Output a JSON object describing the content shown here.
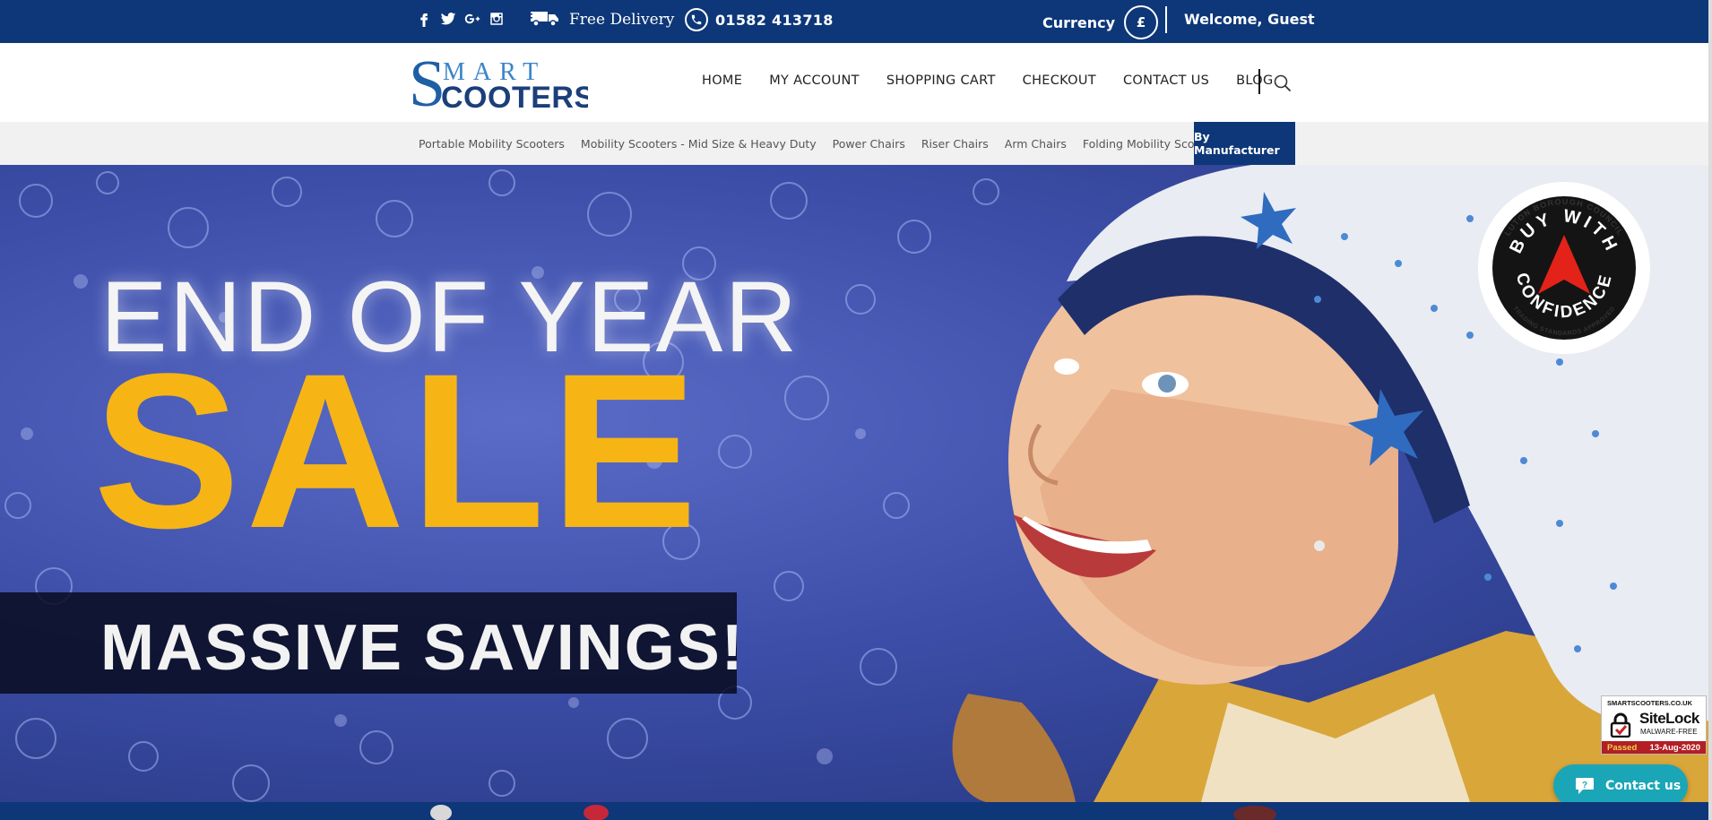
{
  "topbar": {
    "social": [
      {
        "icon": "facebook-icon"
      },
      {
        "icon": "twitter-icon"
      },
      {
        "icon": "google-plus-icon"
      },
      {
        "icon": "instagram-icon"
      }
    ],
    "delivery_icon": "truck-icon",
    "delivery_label": "Free Delivery",
    "phone_icon": "phone-icon",
    "phone_number": "01582 413718",
    "currency_label": "Currency",
    "currency_symbol": "£",
    "welcome_text": "Welcome, Guest"
  },
  "header": {
    "logo_text_top": "MART",
    "logo_text_bottom": "COOTERS",
    "logo_letter": "S",
    "nav": [
      "HOME",
      "MY ACCOUNT",
      "SHOPPING CART",
      "CHECKOUT",
      "CONTACT US",
      "BLOG"
    ],
    "search_icon": "search-icon"
  },
  "categories": {
    "items": [
      "Portable Mobility Scooters",
      "Mobility Scooters - Mid Size & Heavy Duty",
      "Power Chairs",
      "Riser Chairs",
      "Arm Chairs",
      "Folding Mobility Scooters"
    ],
    "active": "By Manufacturer"
  },
  "hero": {
    "line1": "END OF YEAR",
    "line2": "SALE",
    "line3": "MASSIVE SAVINGS!",
    "badge_top": "LUTON BOROUGH COUNCIL",
    "badge_buy": "BUY WITH",
    "badge_confidence": "CONFIDENCE",
    "badge_bottom": "TRADING STANDARDS APPROVED"
  },
  "sitelock": {
    "domain": "SMARTSCOOTERS.CO.UK",
    "brand": "SiteLock",
    "subtitle": "MALWARE-FREE",
    "status": "Passed",
    "date": "13-Aug-2020"
  },
  "contact_button": {
    "label": "Contact us",
    "icon": "chat-bubble-icon"
  },
  "colors": {
    "brand_navy": "#0d3778",
    "sale_yellow": "#f6b514",
    "contact_teal": "#1ba6b8",
    "sitelock_red": "#b21f24"
  }
}
